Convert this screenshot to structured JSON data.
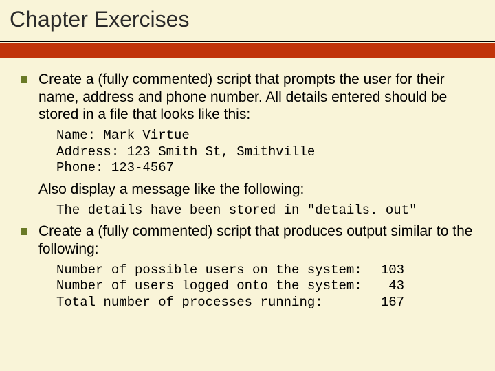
{
  "title": "Chapter Exercises",
  "items": [
    {
      "text": "Create a (fully commented) script that prompts the user for their name, address and phone number.  All details entered should be stored in a file that looks like this:",
      "code": "Name: Mark Virtue\nAddress: 123 Smith St, Smithville\nPhone: 123-4567",
      "followup": "Also display a message like the following:",
      "code2": "The details have been stored in \"details. out\""
    },
    {
      "text": "Create a (fully commented) script that produces output similar to the following:",
      "stats": [
        {
          "label": "Number of possible users on the system: ",
          "value": "103"
        },
        {
          "label": "Number of users logged onto the system: ",
          "value": "43"
        },
        {
          "label": "Total number of processes running:      ",
          "value": "167"
        }
      ]
    }
  ]
}
